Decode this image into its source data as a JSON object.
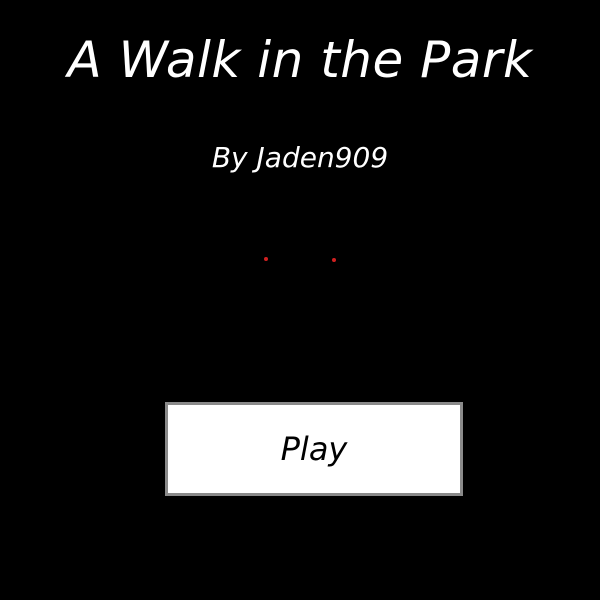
{
  "game": {
    "title": "A Walk in the Park",
    "byline": "By Jaden909",
    "play_label": "Play"
  },
  "colors": {
    "background": "#000000",
    "text": "#ffffff",
    "eyes": "#d02020",
    "button_fill": "#ffffff",
    "button_border": "#8a8a8a"
  }
}
